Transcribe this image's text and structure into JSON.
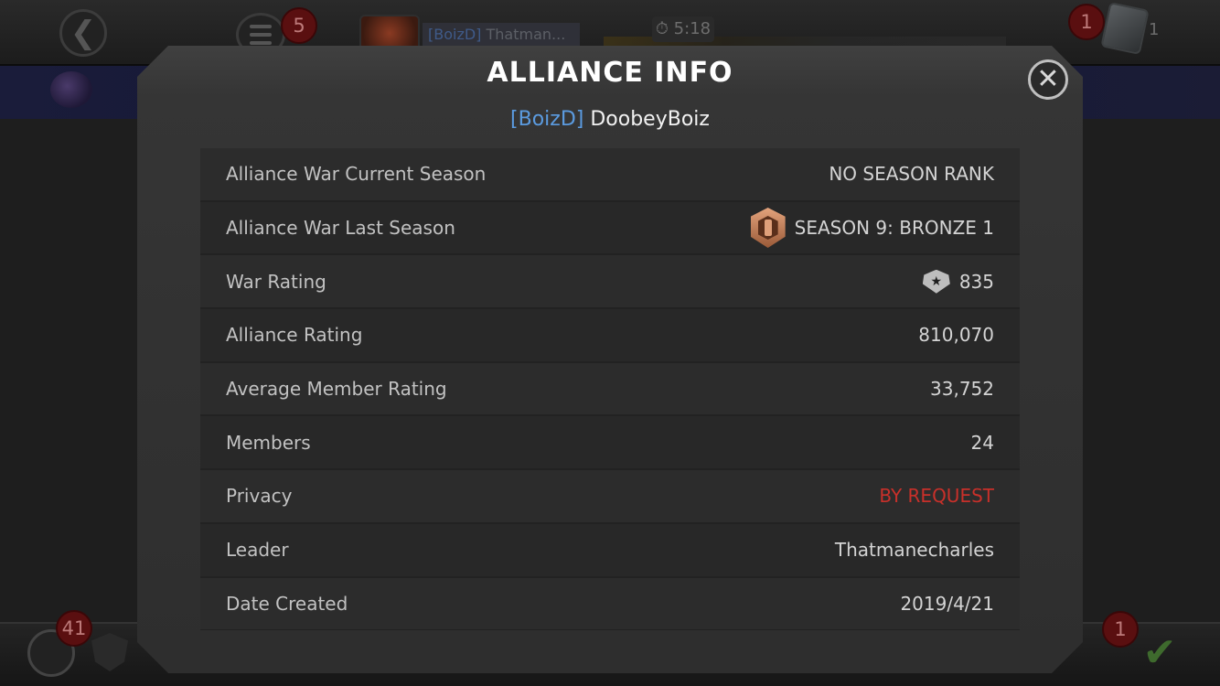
{
  "background": {
    "menu_badge": "5",
    "player_tag": "[BoizD]",
    "player_name": "Thatman...",
    "timer": "5:18",
    "top_right_badge": "1",
    "crystal_count": "1",
    "alliance_badge": "41",
    "quest_badge": "1"
  },
  "modal": {
    "title": "ALLIANCE INFO",
    "alliance_tag": "[BoizD]",
    "alliance_name": "DoobeyBoiz",
    "rows": [
      {
        "label": "Alliance War Current Season",
        "value": "NO SEASON RANK"
      },
      {
        "label": "Alliance War Last Season",
        "value": "SEASON 9: BRONZE 1",
        "icon": "bronze-rank-icon"
      },
      {
        "label": "War Rating",
        "value": "835",
        "icon": "war-rating-icon"
      },
      {
        "label": "Alliance Rating",
        "value": "810,070"
      },
      {
        "label": "Average Member Rating",
        "value": "33,752"
      },
      {
        "label": "Members",
        "value": "24"
      },
      {
        "label": "Privacy",
        "value": "BY REQUEST",
        "color": "#c8302a"
      },
      {
        "label": "Leader",
        "value": "Thatmanecharles"
      },
      {
        "label": "Date Created",
        "value": "2019/4/21"
      }
    ]
  }
}
